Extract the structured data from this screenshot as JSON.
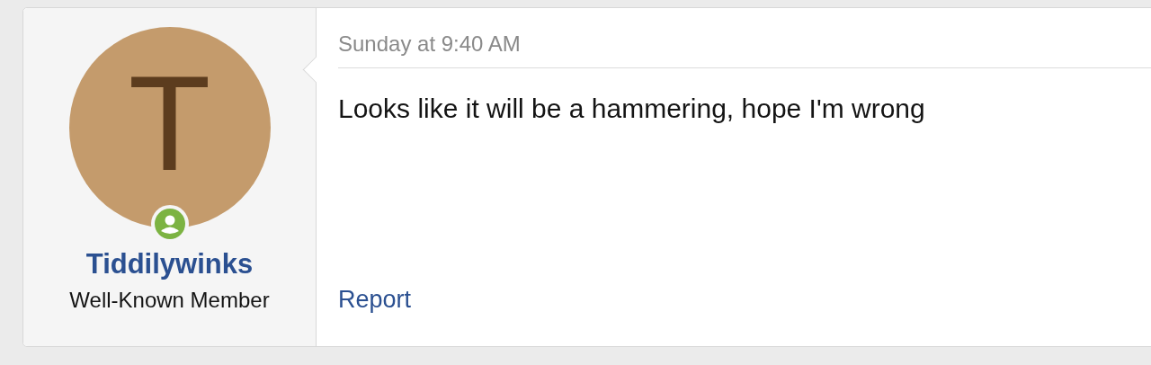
{
  "post": {
    "avatar": {
      "letter": "T",
      "online": true
    },
    "author": "Tiddilywinks",
    "user_title": "Well-Known Member",
    "date": "Sunday at 9:40 AM",
    "message": "Looks like it will be a hammering, hope I'm wrong",
    "actions": [
      "Report"
    ]
  }
}
